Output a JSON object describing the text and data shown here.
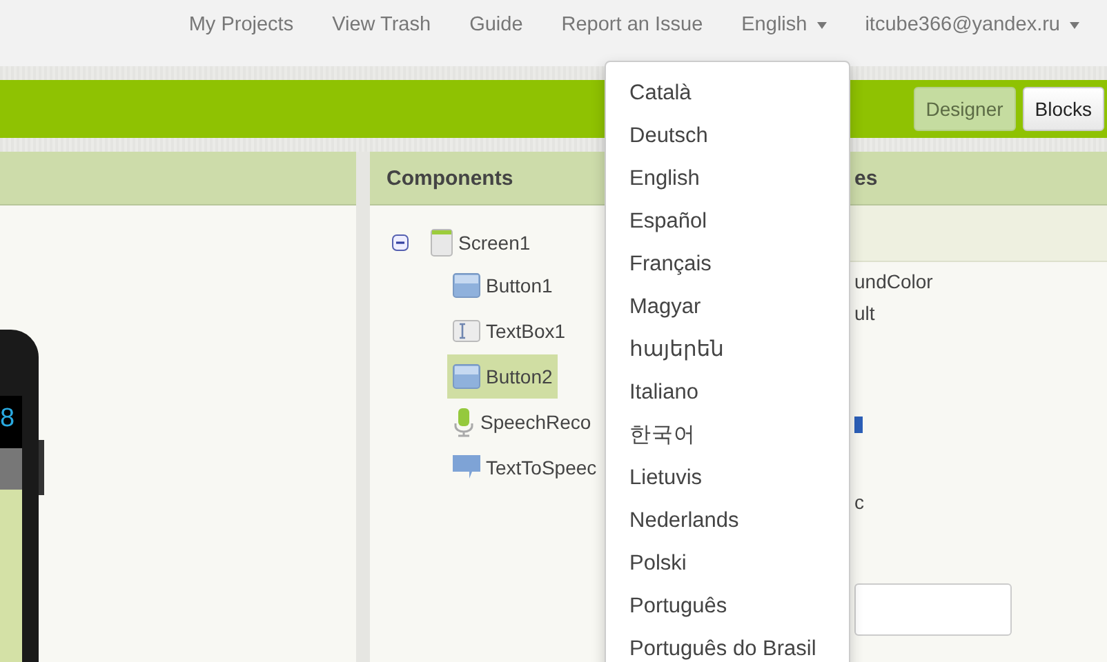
{
  "nav": {
    "links": [
      "My Projects",
      "View Trash",
      "Guide",
      "Report an Issue"
    ],
    "language": "English",
    "account": "itcube366@yandex.ru"
  },
  "toolbar": {
    "buttons": [
      {
        "label": "Designer",
        "selected": true
      },
      {
        "label": "Blocks",
        "selected": false
      }
    ]
  },
  "viewer": {
    "clock": "8"
  },
  "components": {
    "title": "Components",
    "tree": [
      {
        "label": "Screen1",
        "kind": "screen",
        "expanded": true,
        "selected": false,
        "children": [
          {
            "label": "Button1",
            "kind": "button",
            "selected": false
          },
          {
            "label": "TextBox1",
            "kind": "textbox",
            "selected": false
          },
          {
            "label": "Button2",
            "kind": "button",
            "selected": true
          },
          {
            "label": "SpeechReco",
            "kind": "speech",
            "selected": false
          },
          {
            "label": "TextToSpeec",
            "kind": "tts",
            "selected": false
          }
        ]
      }
    ]
  },
  "properties": {
    "title": "es",
    "items": [
      {
        "kind": "text",
        "text": "undColor"
      },
      {
        "kind": "text",
        "text": "ult"
      },
      {
        "kind": "swatch"
      },
      {
        "kind": "text",
        "text": "c"
      },
      {
        "kind": "field"
      }
    ]
  },
  "language_menu": {
    "items": [
      "Català",
      "Deutsch",
      "English",
      "Español",
      "Français",
      "Magyar",
      "հայերեն",
      "Italiano",
      "한국어",
      "Lietuvis",
      "Nederlands",
      "Polski",
      "Português",
      "Português do Brasil"
    ]
  }
}
